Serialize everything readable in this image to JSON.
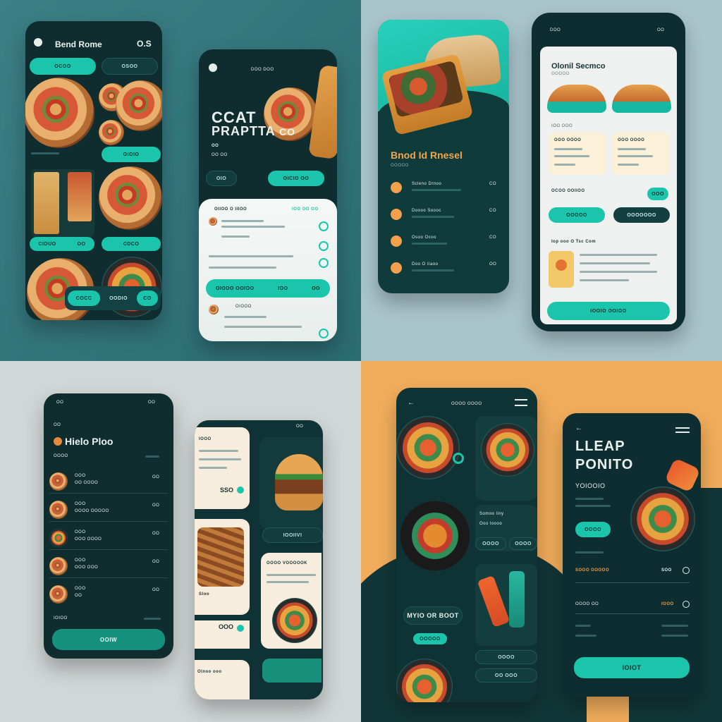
{
  "q1": {
    "phone_a": {
      "title": "Bend Rome",
      "badge": "O.S",
      "tab1": "OCOO",
      "tab2": "OSOO",
      "card_btn": "OIOIO",
      "btn_left": "CIDUO",
      "btn_left_val": "OO",
      "btn_right": "CDCO",
      "bottom_left": "COCC",
      "bottom_mid": "OODIO",
      "bottom_right": "CO"
    },
    "phone_b": {
      "header": "DOO DOO",
      "hero_line1": "CCAT",
      "hero_line2": "PRAPTTA",
      "hero_suffix": "CO",
      "hero_small1": "OO",
      "hero_small2": "OO OO",
      "btn_left": "OIO",
      "btn_right": "OICIO OO",
      "list_title": "OIIOO O IIIOO",
      "list_meta": "IOO OO OO",
      "cta": "OIODO OOIOO",
      "cta_price": "IOO",
      "cta_arrow": "OO",
      "item_label": "OIOOO"
    }
  },
  "q2": {
    "phone_a": {
      "title": "Bnod Id Rnesel",
      "subtitle": "OOOOO",
      "rows": [
        {
          "name": "Scleno Drnoo",
          "price": "CO"
        },
        {
          "name": "Doooo Soooc",
          "price": "CO"
        },
        {
          "name": "Osoo Ocoo",
          "price": "CO"
        },
        {
          "name": "Doo O Iiaoo",
          "price": "OO"
        }
      ]
    },
    "phone_b": {
      "status": "DOO",
      "status_right": "OO",
      "title": "Olonil Secmco",
      "subtitle": "OOOOO",
      "section": "IOO OOO",
      "card1_title": "OOO OOOO",
      "card2_title": "OOO OOOO",
      "filter_label": "OCOO OOIIOO",
      "filter_btn": "OOO",
      "btn_left": "OOOOO",
      "btn_right": "OOOOOOO",
      "list_title": "Iop ooo O Tsc Com",
      "cta": "IOOIO OOIOO"
    }
  },
  "q3": {
    "phone_a": {
      "status": "OO",
      "status_right": "OO",
      "kicker": "OO",
      "title": "Hielo Ploo",
      "subtitle": "OOOO",
      "rows": [
        {
          "name": "OOO",
          "sub": "OO OOOO",
          "price": "OO"
        },
        {
          "name": "OOO",
          "sub": "OOOO OOOOO",
          "price": "OO"
        },
        {
          "name": "OOO",
          "sub": "OOO OOOO",
          "price": "OO"
        },
        {
          "name": "OOO",
          "sub": "OOO OOO",
          "price": "OO"
        },
        {
          "name": "OOO",
          "sub": "OO",
          "price": "OO"
        }
      ],
      "footer_label": "IOIOO",
      "cta": "OOIW"
    },
    "phone_b": {
      "status": "OO",
      "card1_title": "IOOO",
      "card1_price": "SSO",
      "dark_btn": "IOOIIVI",
      "card2_title": "Sloo",
      "card2_price": "OOO",
      "card3_title": "OOOO VOOOOOK",
      "card4_title": "Olnoo ooo"
    }
  },
  "q4": {
    "phone_a": {
      "header": "OOOO OOOO",
      "menu_title": "Somoo liny",
      "menu_sub": "Ooo loooo",
      "chip1": "OOOO",
      "chip2": "OOOO",
      "promo": "MYIO OR BOOT",
      "promo_btn": "OOOOO",
      "bar1": "OOOO",
      "bar2": "OO OOO"
    },
    "phone_b": {
      "title_line1": "LLEAP",
      "title_line2": "PONITO",
      "subtitle": "YOIOOIO",
      "btn": "OOOO",
      "price_label": "SOOO OOOOO",
      "price": "SOO",
      "row1": "OOOO OO",
      "row1_val": "IOOO",
      "cta": "IOIOT"
    }
  }
}
